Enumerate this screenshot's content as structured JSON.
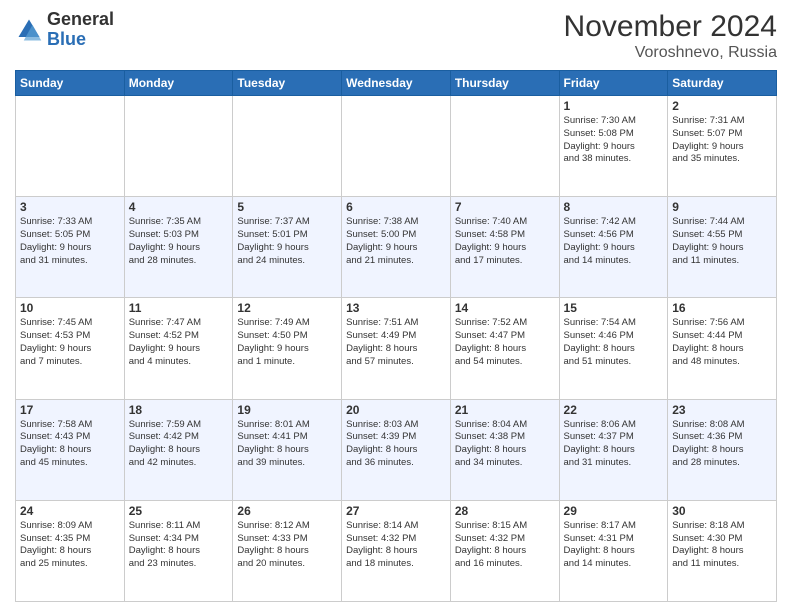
{
  "logo": {
    "general": "General",
    "blue": "Blue"
  },
  "header": {
    "title": "November 2024",
    "subtitle": "Voroshnevo, Russia"
  },
  "days_of_week": [
    "Sunday",
    "Monday",
    "Tuesday",
    "Wednesday",
    "Thursday",
    "Friday",
    "Saturday"
  ],
  "weeks": [
    [
      {
        "day": "",
        "info": ""
      },
      {
        "day": "",
        "info": ""
      },
      {
        "day": "",
        "info": ""
      },
      {
        "day": "",
        "info": ""
      },
      {
        "day": "",
        "info": ""
      },
      {
        "day": "1",
        "info": "Sunrise: 7:30 AM\nSunset: 5:08 PM\nDaylight: 9 hours\nand 38 minutes."
      },
      {
        "day": "2",
        "info": "Sunrise: 7:31 AM\nSunset: 5:07 PM\nDaylight: 9 hours\nand 35 minutes."
      }
    ],
    [
      {
        "day": "3",
        "info": "Sunrise: 7:33 AM\nSunset: 5:05 PM\nDaylight: 9 hours\nand 31 minutes."
      },
      {
        "day": "4",
        "info": "Sunrise: 7:35 AM\nSunset: 5:03 PM\nDaylight: 9 hours\nand 28 minutes."
      },
      {
        "day": "5",
        "info": "Sunrise: 7:37 AM\nSunset: 5:01 PM\nDaylight: 9 hours\nand 24 minutes."
      },
      {
        "day": "6",
        "info": "Sunrise: 7:38 AM\nSunset: 5:00 PM\nDaylight: 9 hours\nand 21 minutes."
      },
      {
        "day": "7",
        "info": "Sunrise: 7:40 AM\nSunset: 4:58 PM\nDaylight: 9 hours\nand 17 minutes."
      },
      {
        "day": "8",
        "info": "Sunrise: 7:42 AM\nSunset: 4:56 PM\nDaylight: 9 hours\nand 14 minutes."
      },
      {
        "day": "9",
        "info": "Sunrise: 7:44 AM\nSunset: 4:55 PM\nDaylight: 9 hours\nand 11 minutes."
      }
    ],
    [
      {
        "day": "10",
        "info": "Sunrise: 7:45 AM\nSunset: 4:53 PM\nDaylight: 9 hours\nand 7 minutes."
      },
      {
        "day": "11",
        "info": "Sunrise: 7:47 AM\nSunset: 4:52 PM\nDaylight: 9 hours\nand 4 minutes."
      },
      {
        "day": "12",
        "info": "Sunrise: 7:49 AM\nSunset: 4:50 PM\nDaylight: 9 hours\nand 1 minute."
      },
      {
        "day": "13",
        "info": "Sunrise: 7:51 AM\nSunset: 4:49 PM\nDaylight: 8 hours\nand 57 minutes."
      },
      {
        "day": "14",
        "info": "Sunrise: 7:52 AM\nSunset: 4:47 PM\nDaylight: 8 hours\nand 54 minutes."
      },
      {
        "day": "15",
        "info": "Sunrise: 7:54 AM\nSunset: 4:46 PM\nDaylight: 8 hours\nand 51 minutes."
      },
      {
        "day": "16",
        "info": "Sunrise: 7:56 AM\nSunset: 4:44 PM\nDaylight: 8 hours\nand 48 minutes."
      }
    ],
    [
      {
        "day": "17",
        "info": "Sunrise: 7:58 AM\nSunset: 4:43 PM\nDaylight: 8 hours\nand 45 minutes."
      },
      {
        "day": "18",
        "info": "Sunrise: 7:59 AM\nSunset: 4:42 PM\nDaylight: 8 hours\nand 42 minutes."
      },
      {
        "day": "19",
        "info": "Sunrise: 8:01 AM\nSunset: 4:41 PM\nDaylight: 8 hours\nand 39 minutes."
      },
      {
        "day": "20",
        "info": "Sunrise: 8:03 AM\nSunset: 4:39 PM\nDaylight: 8 hours\nand 36 minutes."
      },
      {
        "day": "21",
        "info": "Sunrise: 8:04 AM\nSunset: 4:38 PM\nDaylight: 8 hours\nand 34 minutes."
      },
      {
        "day": "22",
        "info": "Sunrise: 8:06 AM\nSunset: 4:37 PM\nDaylight: 8 hours\nand 31 minutes."
      },
      {
        "day": "23",
        "info": "Sunrise: 8:08 AM\nSunset: 4:36 PM\nDaylight: 8 hours\nand 28 minutes."
      }
    ],
    [
      {
        "day": "24",
        "info": "Sunrise: 8:09 AM\nSunset: 4:35 PM\nDaylight: 8 hours\nand 25 minutes."
      },
      {
        "day": "25",
        "info": "Sunrise: 8:11 AM\nSunset: 4:34 PM\nDaylight: 8 hours\nand 23 minutes."
      },
      {
        "day": "26",
        "info": "Sunrise: 8:12 AM\nSunset: 4:33 PM\nDaylight: 8 hours\nand 20 minutes."
      },
      {
        "day": "27",
        "info": "Sunrise: 8:14 AM\nSunset: 4:32 PM\nDaylight: 8 hours\nand 18 minutes."
      },
      {
        "day": "28",
        "info": "Sunrise: 8:15 AM\nSunset: 4:32 PM\nDaylight: 8 hours\nand 16 minutes."
      },
      {
        "day": "29",
        "info": "Sunrise: 8:17 AM\nSunset: 4:31 PM\nDaylight: 8 hours\nand 14 minutes."
      },
      {
        "day": "30",
        "info": "Sunrise: 8:18 AM\nSunset: 4:30 PM\nDaylight: 8 hours\nand 11 minutes."
      }
    ]
  ]
}
